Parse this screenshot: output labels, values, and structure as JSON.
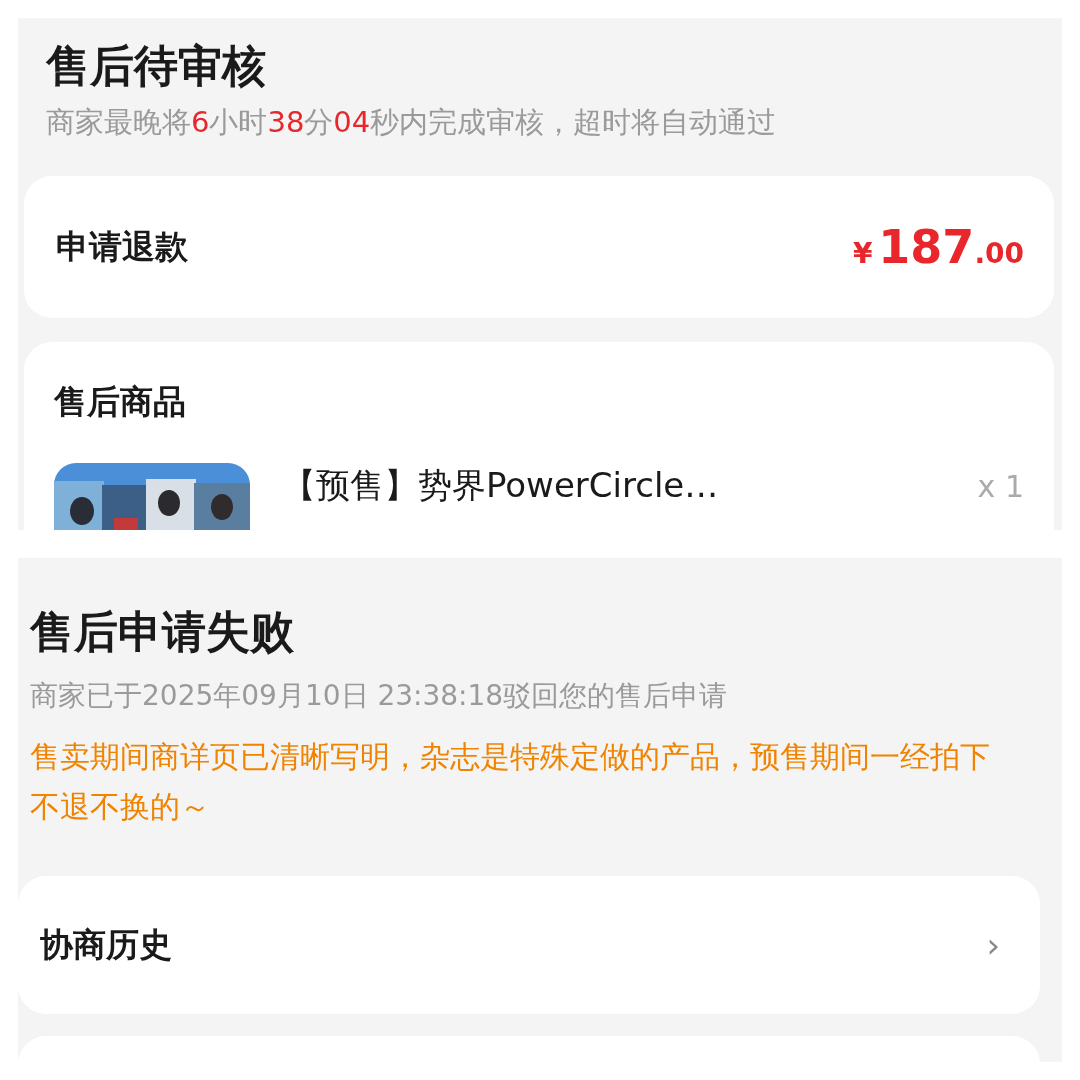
{
  "pending_panel": {
    "title": "售后待审核",
    "subtitle": [
      {
        "text": "商家最晚将",
        "highlight": false
      },
      {
        "text": "6",
        "highlight": true
      },
      {
        "text": "小时",
        "highlight": false
      },
      {
        "text": "38",
        "highlight": true
      },
      {
        "text": "分",
        "highlight": false
      },
      {
        "text": "04",
        "highlight": true
      },
      {
        "text": "秒内完成审核，超时将自动通过",
        "highlight": false
      }
    ],
    "refund": {
      "label": "申请退款",
      "currency": "¥",
      "amount_integer": "187",
      "amount_decimal": ".00"
    },
    "goods": {
      "title": "售后商品",
      "items": [
        {
          "kind": "picture",
          "name": "【预售】势界PowerCircle…",
          "quantity": "x 1"
        }
      ]
    }
  },
  "failed_panel": {
    "title": "售后申请失败",
    "subtitle": "商家已于2025年09月10日 23:38:18驳回您的售后申请",
    "reason": "售卖期间商详页已清晰写明，杂志是特殊定做的产品，预售期间一经拍下不退不换的～",
    "history": {
      "label": "协商历史",
      "chevron": "›"
    }
  }
}
